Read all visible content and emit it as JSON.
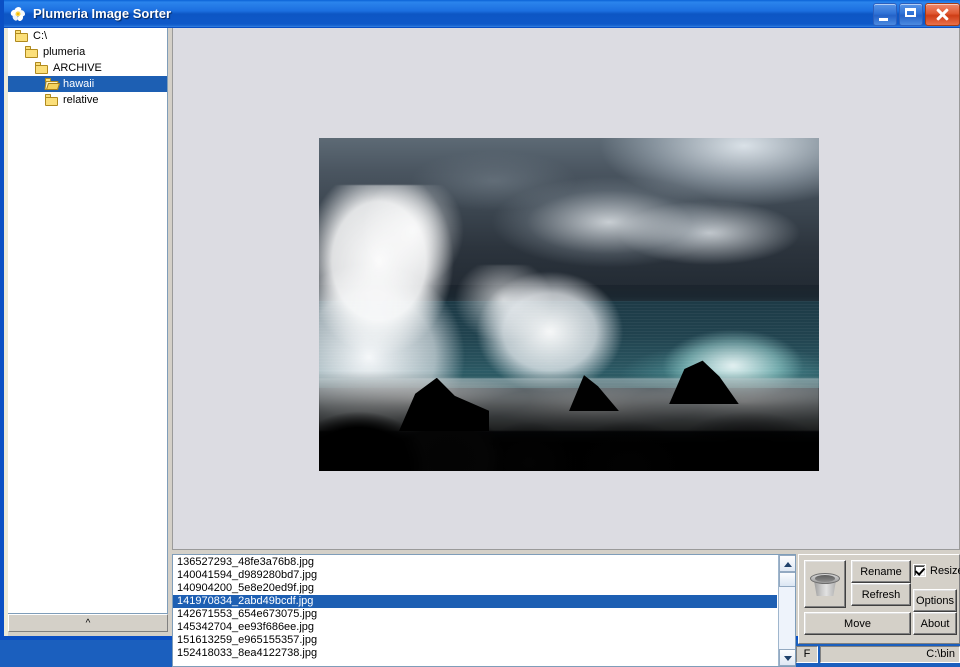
{
  "window": {
    "title": "Plumeria Image Sorter",
    "icon": "plumeria-flower-icon",
    "minimize_label": "Minimize",
    "maximize_label": "Maximize",
    "close_label": "Close"
  },
  "tree": {
    "items": [
      {
        "label": "C:\\",
        "indent": 0,
        "state": "closed",
        "selected": false
      },
      {
        "label": "plumeria",
        "indent": 1,
        "state": "closed",
        "selected": false
      },
      {
        "label": "ARCHIVE",
        "indent": 2,
        "state": "closed",
        "selected": false
      },
      {
        "label": "hawaii",
        "indent": 3,
        "state": "open",
        "selected": true
      },
      {
        "label": "relative",
        "indent": 3,
        "state": "closed",
        "selected": false
      }
    ],
    "collapse_label": "^"
  },
  "viewer": {
    "image_alt": "stormy-ocean-wave-crashing-on-volcanic-rocks",
    "background": "#dcdce2"
  },
  "filelist": {
    "files": [
      {
        "name": "136527293_48fe3a76b8.jpg",
        "selected": false
      },
      {
        "name": "140041594_d989280bd7.jpg",
        "selected": false
      },
      {
        "name": "140904200_5e8e20ed9f.jpg",
        "selected": false
      },
      {
        "name": "141970834_2abd49bcdf.jpg",
        "selected": true
      },
      {
        "name": "142671553_654e673075.jpg",
        "selected": false
      },
      {
        "name": "145342704_ee93f686ee.jpg",
        "selected": false
      },
      {
        "name": "151613259_e965155357.jpg",
        "selected": false
      },
      {
        "name": "152418033_8ea4122738.jpg",
        "selected": false
      }
    ],
    "scroll_up_label": "Scroll up",
    "scroll_down_label": "Scroll down"
  },
  "toolbox": {
    "bucket_label": "bucket-icon",
    "rename_label": "Rename",
    "refresh_label": "Refresh",
    "move_label": "Move",
    "options_label": "Options",
    "about_label": "About",
    "resize_label": "Resize",
    "resize_checked": true
  },
  "statusbar": {
    "left": "F",
    "right": "C:\\bin"
  },
  "colors": {
    "title_blue": "#1c6fe0",
    "selection_blue": "#1d5fb3",
    "face": "#d4d0c8",
    "viewer_bg": "#dcdce2"
  }
}
